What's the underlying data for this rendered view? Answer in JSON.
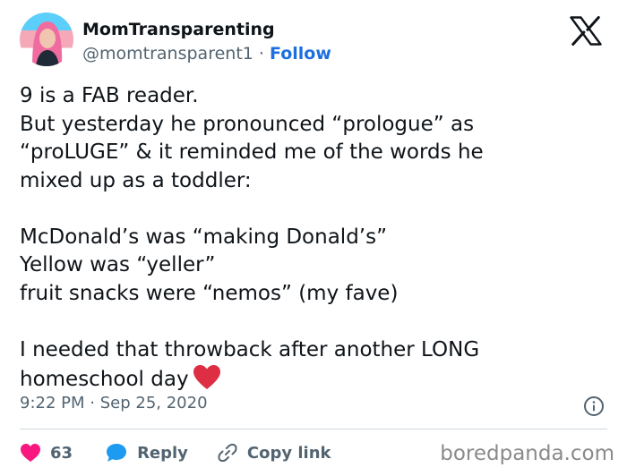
{
  "author": {
    "name": "MomTransparenting",
    "handle": "@momtransparent1",
    "separator": "·",
    "follow_label": "Follow"
  },
  "tweet": {
    "lines": [
      "9 is a FAB reader.",
      "But yesterday he pronounced “prologue” as",
      "“proLUGE” & it reminded me of the words he",
      "mixed up as a toddler:",
      "",
      "McDonald’s was “making Donald’s”",
      "Yellow was “yeller”",
      "fruit snacks were “nemos” (my fave)",
      "",
      "I needed that throwback after another LONG",
      "homeschool day"
    ],
    "emoji": "heart-emoji"
  },
  "meta": {
    "time": "9:22 PM",
    "separator": "·",
    "date": "Sep 25, 2020"
  },
  "actions": {
    "like_count": "63",
    "reply_label": "Reply",
    "copy_link_label": "Copy link"
  },
  "watermark": "boredpanda.com",
  "colors": {
    "accent": "#1d6fe0",
    "like": "#f91880",
    "reply_icon": "#1d9bf0",
    "heart_emoji": "#dd2e44",
    "muted_text": "#536471"
  }
}
